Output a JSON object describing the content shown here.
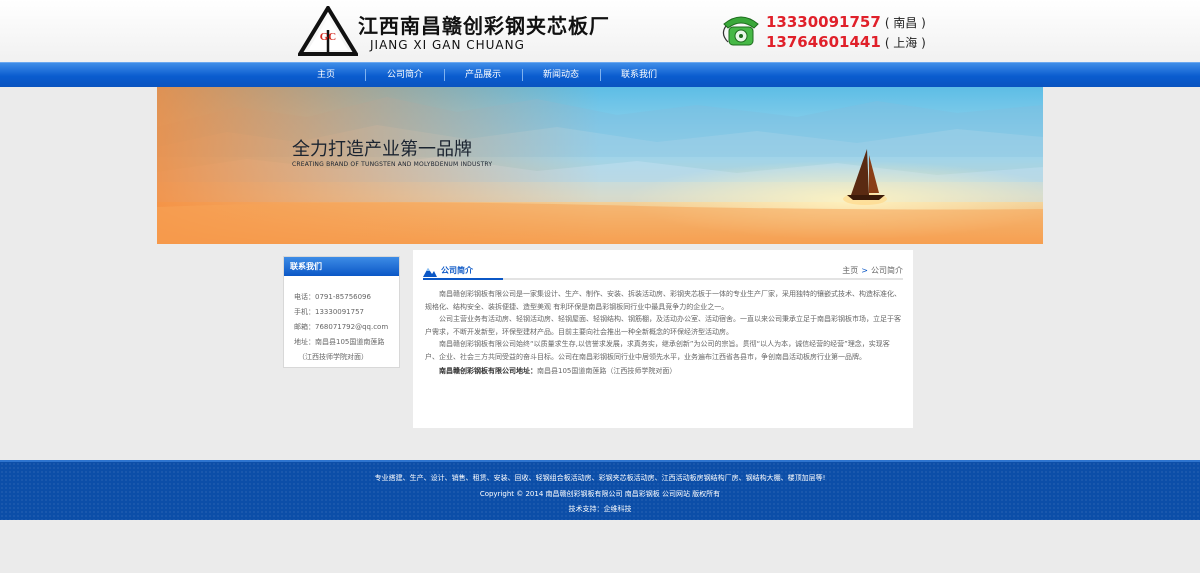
{
  "header": {
    "company_name": "江西南昌赣创彩钢夹芯板厂",
    "company_pinyin": "JIANG XI GAN CHUANG",
    "logo_letters": "GC",
    "phones": [
      {
        "number": "13330091757",
        "city": "( 南昌 )"
      },
      {
        "number": "13764601441",
        "city": "( 上海 )"
      }
    ]
  },
  "nav": {
    "items": [
      "主页",
      "公司简介",
      "产品展示",
      "新闻动态",
      "联系我们"
    ]
  },
  "banner": {
    "title": "全力打造产业第一品牌",
    "subtitle": "CREATING BRAND OF TUNGSTEN AND MOLYBDENUM INDUSTRY"
  },
  "sidebar": {
    "title": "联系我们",
    "lines": [
      "电话：0791-85756096",
      "手机：13330091757",
      "邮箱：768071792@qq.com",
      "地址：南昌县105国道南莲路",
      "（江西技师学院对面）"
    ]
  },
  "content": {
    "title": "公司简介",
    "breadcrumb_home": "主页",
    "breadcrumb_arrow": ">",
    "breadcrumb_current": "公司简介",
    "paragraphs": [
      "南昌赣创彩钢板有限公司是一家集设计、生产、制作、安装、拆装活动房、彩钢夹芯板于一体的专业生产厂家，采用独特的镶嵌式技术、构造标准化、规格化、结构安全、装拆便捷、造型美观 有利环保是南昌彩钢板同行业中最具竞争力的企业之一。",
      "公司主营业务有活动房、轻钢活动房、轻钢屋面、轻钢结构、钢筋棚，及活动办公室、活动宿舍。一直以来公司秉承立足于南昌彩钢板市场，立足于客户需求，不断开发新型，环保型建材产品。目前主要向社会推出一种全新概念的环保经济型活动房。",
      "南昌赣创彩钢板有限公司始终“以质量求生存,以信誉求发展，求真务实，继承创新”为公司的宗旨。贯彻“以人为本，诚信经营的经营”理念，实现客户、企业、社会三方共同受益的奋斗目标。公司在南昌彩钢板同行业中居领先水平，业务遍布江西省各县市，争创南昌活动板房行业第一品牌。"
    ],
    "address_label": "南昌赣创彩钢板有限公司地址：",
    "address_value": "南昌县105国道南莲路（江西技师学院对面）"
  },
  "footer": {
    "line1": "专业搭建、生产、设计、销售、租赁、安装、回收、轻钢组合板活动房、彩钢夹芯板活动房、江西活动板房钢结构厂房、钢结构大棚、楼顶加层等!",
    "line2": "Copyright © 2014 南昌赣创彩钢板有限公司 南昌彩钢板 公司网站 版权所有",
    "line3": "技术支持：企维科技"
  },
  "colors": {
    "nav_blue": "#0a5ccf",
    "phone_red": "#e0202a",
    "footer_blue": "#0c4ea8",
    "logo_red": "#d4281e"
  }
}
